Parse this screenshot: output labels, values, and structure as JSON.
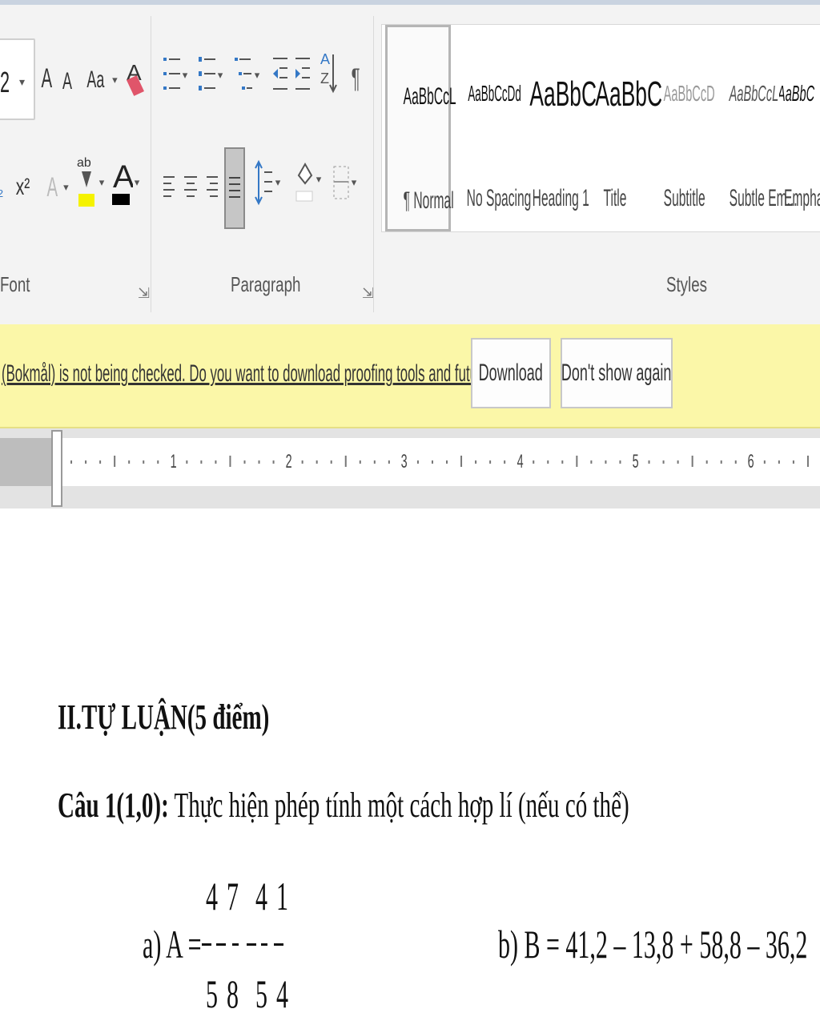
{
  "ribbon": {
    "font_size_value": "2",
    "groups": {
      "font_label": "Font",
      "paragraph_label": "Paragraph",
      "styles_label": "Styles"
    },
    "icons": {
      "grow_font": "A",
      "shrink_font": "A",
      "change_case": "Aa",
      "superscript": "x²",
      "text_effects": "A",
      "highlight": "ab",
      "font_color": "A",
      "pilcrow": "¶"
    },
    "styles": [
      {
        "sample": "AaBbCcL",
        "name": "¶ Normal"
      },
      {
        "sample": "AaBbCcDd",
        "name": "No Spacing"
      },
      {
        "sample": "AaBbC",
        "name": "Heading 1"
      },
      {
        "sample": "AaBbC",
        "name": "Title"
      },
      {
        "sample": "AaBbCcD",
        "name": "Subtitle"
      },
      {
        "sample": "AaBbCcL",
        "name": "Subtle Em..."
      },
      {
        "sample": "AaBbC",
        "name": "Empha"
      }
    ],
    "colors": {
      "highlight": "#f5f200",
      "font_color": "#000000"
    }
  },
  "infobar": {
    "message": "(Bokmål) is not being checked. Do you want to download proofing tools and future updates?",
    "download_label": "Download",
    "dont_show_label": "Don't show again"
  },
  "ruler": {
    "numbers": [
      "1",
      "2",
      "3",
      "4",
      "5",
      "6"
    ]
  },
  "document": {
    "heading": "II.TỰ LUẬN(5 điểm)",
    "question_label": "Câu 1(1,0):",
    "question_text": " Thực hiện phép tính một cách hợp lí (nếu có thể)",
    "part_a_label": "a) A = ",
    "fraction_numerators": [
      "4",
      "7",
      "4",
      "1"
    ],
    "fraction_denominators": [
      "5",
      "8",
      "5",
      "4"
    ],
    "part_b": "b) B = 41,2 – 13,8 + 58,8 – 36,2"
  }
}
